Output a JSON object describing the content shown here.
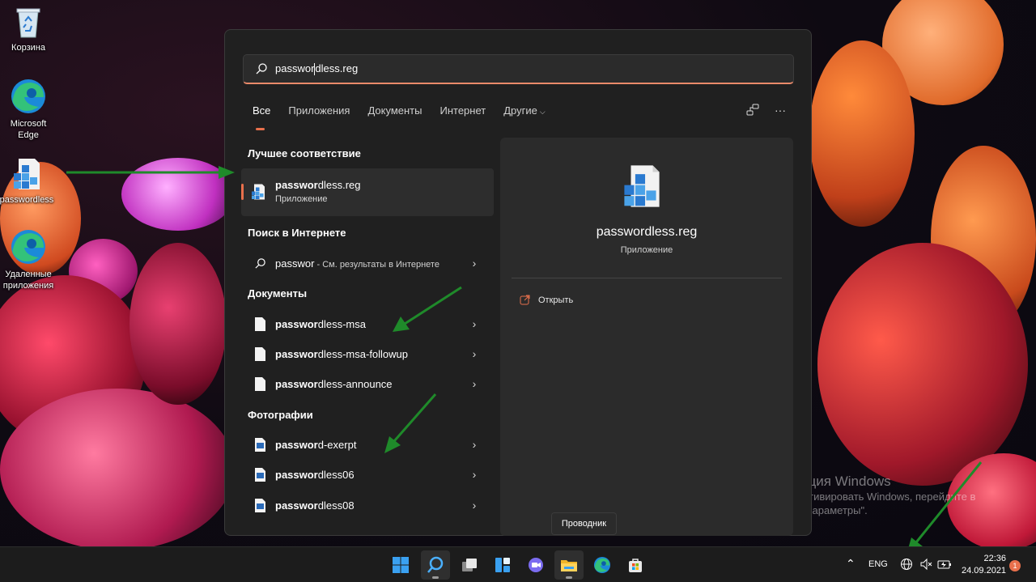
{
  "desktop": {
    "icons": [
      {
        "label": "Корзина"
      },
      {
        "label": "Microsoft Edge"
      },
      {
        "label": "passwordless"
      },
      {
        "label": "Удаленные приложения"
      }
    ],
    "activation": {
      "title": "Активация Windows",
      "text": "Чтобы активировать Windows, перейдите в раздел \"Параметры\"."
    }
  },
  "search": {
    "query_typed": "passwor",
    "query_rest": "dless.reg"
  },
  "tabs": [
    {
      "label": "Все",
      "active": true
    },
    {
      "label": "Приложения"
    },
    {
      "label": "Документы"
    },
    {
      "label": "Интернет"
    },
    {
      "label": "Другие"
    }
  ],
  "tools": {
    "more_label": "···"
  },
  "sections": {
    "best_match": "Лучшее соответствие",
    "web": "Поиск в Интернете",
    "documents": "Документы",
    "photos": "Фотографии"
  },
  "best_match": {
    "bold": "passwor",
    "rest": "dless.reg",
    "type": "Приложение"
  },
  "web_result": {
    "query": "passwor",
    "suffix": " - См. результаты в Интернете"
  },
  "documents": [
    {
      "bold": "passwor",
      "rest": "dless-msa"
    },
    {
      "bold": "passwor",
      "rest": "dless-msa-followup"
    },
    {
      "bold": "passwor",
      "rest": "dless-announce"
    }
  ],
  "photos": [
    {
      "bold": "passwor",
      "rest": "d-exerpt"
    },
    {
      "bold": "passwor",
      "rest": "dless06"
    },
    {
      "bold": "passwor",
      "rest": "dless08"
    }
  ],
  "preview": {
    "name": "passwordless.reg",
    "type": "Приложение",
    "action_open": "Открыть"
  },
  "tooltip": "Проводник",
  "taskbar": {
    "language": "ENG",
    "time": "22:36",
    "date": "24.09.2021",
    "notifications": "1"
  },
  "colors": {
    "accent": "#e8704c",
    "panel": "#202020",
    "arrow": "#1f8a2a"
  }
}
